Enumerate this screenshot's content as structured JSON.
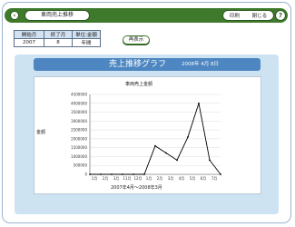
{
  "header": {
    "icon": "back-icon",
    "title": "車両売上推移",
    "buttons": [
      "印刷",
      "閉じる"
    ],
    "help": "?"
  },
  "info_table": {
    "headers": [
      "開始月",
      "終了月",
      "単位:金額"
    ],
    "values": [
      "2007",
      "8",
      "年間"
    ]
  },
  "redisplay_label": "再表示",
  "chart_header": {
    "title": "売上推移グラフ",
    "date": "2008年 4月 8日"
  },
  "chart_data": {
    "type": "line",
    "title": "車両売上金額",
    "ylabel": "金額",
    "xlabel": "2007年4月〜2008年3月",
    "categories": [
      "1月",
      "2月",
      "3月",
      "11月",
      "12月",
      "1月",
      "2月",
      "3月",
      "4月",
      "5月",
      "6月",
      "7月"
    ],
    "series": [
      {
        "values": [
          0,
          0,
          0,
          0,
          0,
          0,
          1600000,
          1200000,
          800000,
          2100000,
          4000000,
          800000,
          0
        ]
      }
    ],
    "yticks": [
      "0",
      "500000",
      "1000000",
      "1500000",
      "2000000",
      "2500000",
      "3000000",
      "3500000",
      "4000000",
      "4500000"
    ],
    "ylim": [
      0,
      4500000
    ],
    "grid": true,
    "line_color": "#000000"
  }
}
